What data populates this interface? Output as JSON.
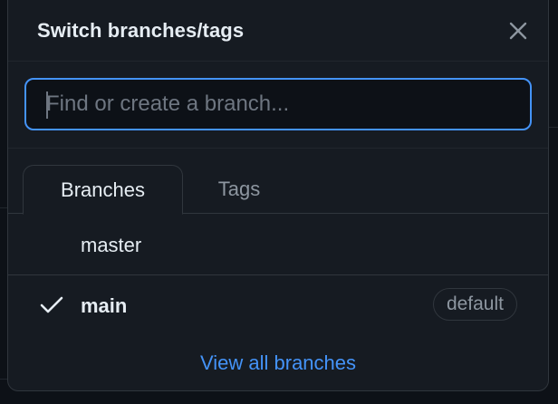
{
  "dialog": {
    "title": "Switch branches/tags",
    "close_icon": "close-icon"
  },
  "search": {
    "value": "",
    "placeholder": "Find or create a branch..."
  },
  "tabs": [
    {
      "label": "Branches",
      "active": true
    },
    {
      "label": "Tags",
      "active": false
    }
  ],
  "branches": [
    {
      "name": "master",
      "checked": false,
      "badge": ""
    },
    {
      "name": "main",
      "checked": true,
      "badge": "default"
    }
  ],
  "footer": {
    "view_all_label": "View all branches"
  },
  "colors": {
    "background": "#161b22",
    "text": "#e6edf3",
    "muted": "#8d96a0",
    "accent": "#4493f8",
    "border": "#30363d"
  }
}
